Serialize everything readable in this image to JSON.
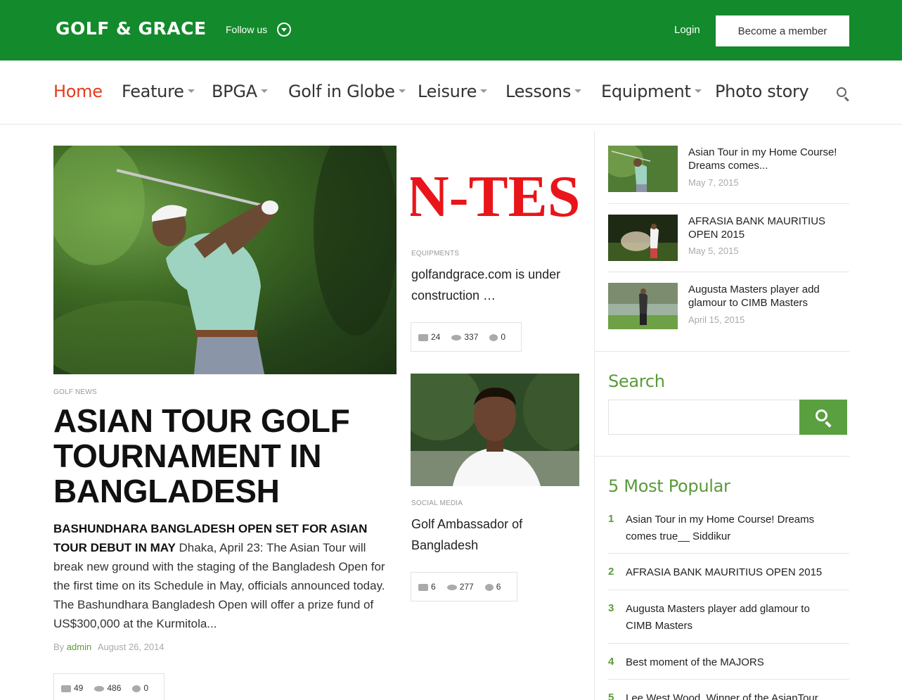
{
  "header": {
    "logo": "GOLF & GRACE",
    "follow_label": "Follow us",
    "login_label": "Login",
    "member_label": "Become a member"
  },
  "nav": {
    "items": [
      {
        "label": "Home",
        "has_caret": false,
        "active": true
      },
      {
        "label": "Feature",
        "has_caret": true
      },
      {
        "label": "BPGA",
        "has_caret": true
      },
      {
        "label": "Golf in Globe",
        "has_caret": true
      },
      {
        "label": "Leisure",
        "has_caret": true
      },
      {
        "label": "Lessons",
        "has_caret": true
      },
      {
        "label": "Equipment",
        "has_caret": true
      },
      {
        "label": "Photo story",
        "has_caret": false
      }
    ]
  },
  "feature": {
    "category": "GOLF NEWS",
    "title": "ASIAN TOUR GOLF TOURNAMENT IN BANGLADESH",
    "excerpt_bold": "BASHUNDHARA BANGLADESH OPEN SET FOR ASIAN TOUR DEBUT IN MAY",
    "excerpt": " Dhaka, April 23: The Asian Tour will break new ground with the staging of the Bangladesh Open for the first time on its Schedule in May, officials announced today. The Bashundhara Bangladesh Open will offer a prize fund of US$300,000 at the Kurmitola...",
    "by_label": "By",
    "author": "admin",
    "date": "August 26, 2014",
    "likes": "49",
    "views": "486",
    "comments": "0"
  },
  "middle": {
    "post1": {
      "image_text": "N-TES",
      "category": "EQUIPMENTS",
      "title": "golfandgrace.com is under construction …",
      "likes": "24",
      "views": "337",
      "comments": "0"
    },
    "post2": {
      "category": "SOCIAL MEDIA",
      "title": "Golf Ambassador of Bangladesh",
      "likes": "6",
      "views": "277",
      "comments": "6"
    }
  },
  "sidebar": {
    "recent": [
      {
        "title": "Asian Tour in my Home Course! Dreams comes...",
        "date": "May 7, 2015"
      },
      {
        "title": "AFRASIA BANK MAURITIUS OPEN 2015",
        "date": "May 5, 2015"
      },
      {
        "title": "Augusta Masters player add glamour to CIMB Masters",
        "date": "April 15, 2015"
      }
    ],
    "search_title": "Search",
    "search_value": "",
    "popular_title": "5 Most Popular",
    "popular": [
      {
        "num": "1",
        "title": "Asian Tour in my Home Course! Dreams comes true__ Siddikur"
      },
      {
        "num": "2",
        "title": "AFRASIA BANK MAURITIUS OPEN 2015"
      },
      {
        "num": "3",
        "title": "Augusta Masters player add glamour to CIMB Masters"
      },
      {
        "num": "4",
        "title": "Best moment of the MAJORS"
      },
      {
        "num": "5",
        "title": "Lee West Wood, Winner of the AsianTour"
      }
    ]
  },
  "colors": {
    "brand_green": "#138a2b",
    "accent_green": "#5a9a3a",
    "active_nav": "#e23b1e"
  }
}
